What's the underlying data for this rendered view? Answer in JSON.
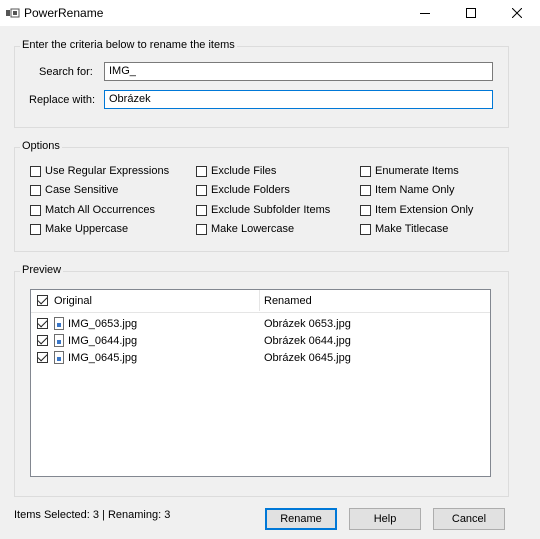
{
  "window": {
    "title": "PowerRename",
    "minimize_glyph": "—",
    "maximize_glyph": "☐",
    "close_glyph": "✕"
  },
  "criteria": {
    "group_title": "Enter the criteria below to rename the items",
    "search_label": "Search for:",
    "search_value": "IMG_",
    "replace_label": "Replace with:",
    "replace_value": "Obrázek"
  },
  "options": {
    "group_title": "Options",
    "items": [
      {
        "label": "Use Regular Expressions",
        "checked": false
      },
      {
        "label": "Case Sensitive",
        "checked": false
      },
      {
        "label": "Match All Occurrences",
        "checked": false
      },
      {
        "label": "Make Uppercase",
        "checked": false
      },
      {
        "label": "Exclude Files",
        "checked": false
      },
      {
        "label": "Exclude Folders",
        "checked": false
      },
      {
        "label": "Exclude Subfolder Items",
        "checked": false
      },
      {
        "label": "Make Lowercase",
        "checked": false
      },
      {
        "label": "Enumerate Items",
        "checked": false
      },
      {
        "label": "Item Name Only",
        "checked": false
      },
      {
        "label": "Item Extension Only",
        "checked": false
      },
      {
        "label": "Make Titlecase",
        "checked": false
      }
    ]
  },
  "preview": {
    "group_title": "Preview",
    "col_original": "Original",
    "col_renamed": "Renamed",
    "header_checked": true,
    "rows": [
      {
        "original": "IMG_0653.jpg",
        "renamed": "Obrázek 0653.jpg",
        "checked": true
      },
      {
        "original": "IMG_0644.jpg",
        "renamed": "Obrázek 0644.jpg",
        "checked": true
      },
      {
        "original": "IMG_0645.jpg",
        "renamed": "Obrázek 0645.jpg",
        "checked": true
      }
    ]
  },
  "status": {
    "text": "Items Selected: 3 | Renaming: 3"
  },
  "buttons": {
    "rename": "Rename",
    "help": "Help",
    "cancel": "Cancel"
  },
  "colors": {
    "focus_accent": "#0078d7",
    "window_bg": "#f0f0f0",
    "file_icon_accent": "#3a77c8"
  }
}
